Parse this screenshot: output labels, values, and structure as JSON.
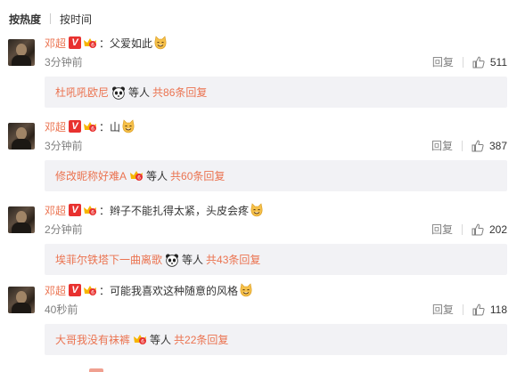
{
  "sort_tabs": {
    "hot": "按热度",
    "time": "按时间"
  },
  "colors": {
    "username": "#eb7350",
    "reply_bg": "#f2f2f5",
    "verified": "#e8312f"
  },
  "comments": [
    {
      "user": "邓超",
      "verified_badge": "V",
      "vip_icon": "vip-crown-icon",
      "colon": "：",
      "text": "父爱如此",
      "emoji": "cat-grin-emoji",
      "time": "3分钟前",
      "reply_label": "回复",
      "likes": "511",
      "replies": {
        "user": "杜吼吼欧尼",
        "icon": "panda-icon",
        "etc": "等人",
        "total": "共86条回复"
      }
    },
    {
      "user": "邓超",
      "verified_badge": "V",
      "vip_icon": "vip-crown-icon",
      "colon": "：",
      "text": "山",
      "emoji": "cat-grin-emoji",
      "time": "3分钟前",
      "reply_label": "回复",
      "likes": "387",
      "replies": {
        "user": "修改昵称好难A",
        "icon": "vip-crown-icon",
        "etc": "等人",
        "total": "共60条回复"
      }
    },
    {
      "user": "邓超",
      "verified_badge": "V",
      "vip_icon": "vip-crown-icon",
      "colon": "：",
      "text": "辫子不能扎得太紧，头皮会疼",
      "emoji": "cat-grin-emoji",
      "time": "2分钟前",
      "reply_label": "回复",
      "likes": "202",
      "replies": {
        "user": "埃菲尔铁塔下一曲离歌",
        "icon": "panda-icon",
        "etc": "等人",
        "total": "共43条回复"
      }
    },
    {
      "user": "邓超",
      "verified_badge": "V",
      "vip_icon": "vip-crown-icon",
      "colon": "：",
      "text": "可能我喜欢这种随意的风格",
      "emoji": "cat-grin-emoji",
      "time": "40秒前",
      "reply_label": "回复",
      "likes": "118",
      "replies": {
        "user": "大哥我没有袜裤",
        "icon": "vip-crown-icon",
        "etc": "等人",
        "total": "共22条回复"
      }
    }
  ]
}
